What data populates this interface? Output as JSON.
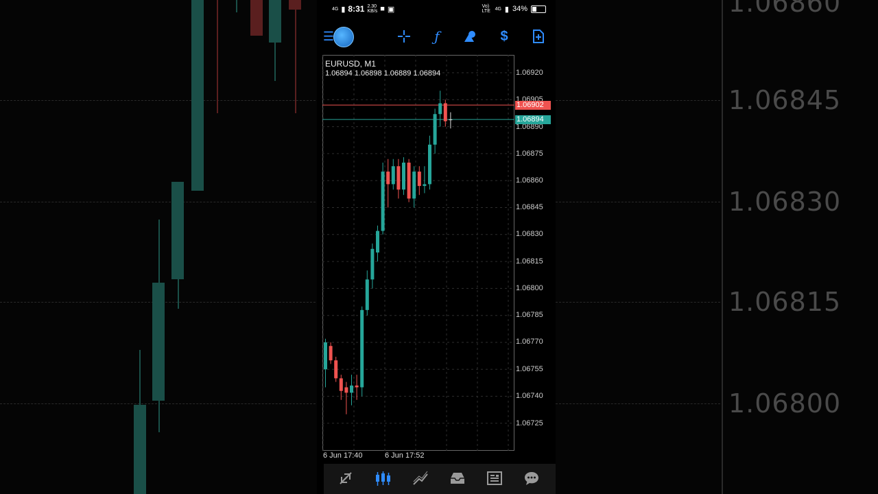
{
  "statusbar": {
    "network": "4G",
    "time": "8:31",
    "speed_value": "2.30",
    "speed_unit": "KB/s",
    "volte": "Vo) LTE",
    "network_right": "4G",
    "battery": "34%"
  },
  "chart": {
    "symbol": "EURUSD, M1",
    "ohlc": "1.06894 1.06898 1.06889 1.06894",
    "y_ticks": [
      "1.06920",
      "1.06905",
      "1.06890",
      "1.06875",
      "1.06860",
      "1.06845",
      "1.06830",
      "1.06815",
      "1.06800",
      "1.06785",
      "1.06770",
      "1.06755",
      "1.06740",
      "1.06725"
    ],
    "ask_price": "1.06902",
    "bid_price": "1.06894",
    "x_labels": [
      "6 Jun 17:40",
      "6 Jun 17:52"
    ],
    "colors": {
      "bull": "#26a69a",
      "bear": "#ef5350",
      "ask_line": "#ef5350",
      "bid_line": "#26a69a",
      "grid": "#2e2e2e"
    }
  },
  "chart_data": {
    "type": "candlestick",
    "title": "EURUSD, M1",
    "ylim": [
      1.06715,
      1.06935
    ],
    "candles": [
      {
        "o": 1.06755,
        "h": 1.06772,
        "l": 1.06745,
        "c": 1.0677
      },
      {
        "o": 1.06768,
        "h": 1.0677,
        "l": 1.06758,
        "c": 1.0676
      },
      {
        "o": 1.0676,
        "h": 1.06762,
        "l": 1.06748,
        "c": 1.0675
      },
      {
        "o": 1.0675,
        "h": 1.06752,
        "l": 1.06738,
        "c": 1.06743
      },
      {
        "o": 1.06745,
        "h": 1.06748,
        "l": 1.0673,
        "c": 1.06742
      },
      {
        "o": 1.06742,
        "h": 1.06752,
        "l": 1.06735,
        "c": 1.06746
      },
      {
        "o": 1.06746,
        "h": 1.06752,
        "l": 1.06738,
        "c": 1.06745
      },
      {
        "o": 1.06745,
        "h": 1.0679,
        "l": 1.0674,
        "c": 1.06788
      },
      {
        "o": 1.06788,
        "h": 1.0681,
        "l": 1.06785,
        "c": 1.06805
      },
      {
        "o": 1.06805,
        "h": 1.06825,
        "l": 1.068,
        "c": 1.06822
      },
      {
        "o": 1.0682,
        "h": 1.06835,
        "l": 1.06815,
        "c": 1.06832
      },
      {
        "o": 1.06832,
        "h": 1.0687,
        "l": 1.0683,
        "c": 1.06865
      },
      {
        "o": 1.06865,
        "h": 1.06872,
        "l": 1.06845,
        "c": 1.06858
      },
      {
        "o": 1.06858,
        "h": 1.06872,
        "l": 1.06855,
        "c": 1.06868
      },
      {
        "o": 1.06868,
        "h": 1.06872,
        "l": 1.0685,
        "c": 1.06855
      },
      {
        "o": 1.06855,
        "h": 1.06873,
        "l": 1.06852,
        "c": 1.0687
      },
      {
        "o": 1.0687,
        "h": 1.06872,
        "l": 1.06848,
        "c": 1.0685
      },
      {
        "o": 1.0685,
        "h": 1.06868,
        "l": 1.06845,
        "c": 1.06865
      },
      {
        "o": 1.06865,
        "h": 1.06868,
        "l": 1.06852,
        "c": 1.06857
      },
      {
        "o": 1.06857,
        "h": 1.06868,
        "l": 1.06853,
        "c": 1.06858
      },
      {
        "o": 1.06858,
        "h": 1.06885,
        "l": 1.06855,
        "c": 1.0688
      },
      {
        "o": 1.0688,
        "h": 1.069,
        "l": 1.06875,
        "c": 1.06897
      },
      {
        "o": 1.06897,
        "h": 1.0691,
        "l": 1.0689,
        "c": 1.06903
      },
      {
        "o": 1.06903,
        "h": 1.06905,
        "l": 1.0689,
        "c": 1.06893
      },
      {
        "o": 1.06894,
        "h": 1.06898,
        "l": 1.06889,
        "c": 1.06894
      }
    ],
    "ask": 1.06902,
    "bid": 1.06894
  },
  "background": {
    "labels": [
      "1.06860",
      "1.06845",
      "1.06830",
      "1.06815",
      "1.06800"
    ]
  },
  "toolbar": {
    "icons": [
      "menu-icon",
      "metatrader-logo",
      "crosshair-icon",
      "indicators-icon",
      "objects-icon",
      "symbol-price-icon",
      "new-order-icon"
    ]
  },
  "bottom_nav": {
    "items": [
      "quotes-icon",
      "chart-icon",
      "trade-icon",
      "history-icon",
      "news-icon",
      "messages-icon"
    ]
  }
}
